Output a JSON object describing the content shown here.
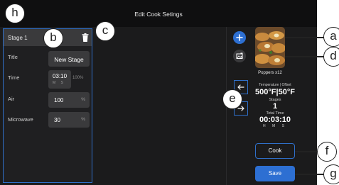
{
  "header": {
    "title": "Edit Cook Setings"
  },
  "stage": {
    "name": "Stage 1",
    "fields": {
      "title": {
        "label": "Title",
        "value": "New Stage"
      },
      "time": {
        "label": "Time",
        "value": "03:10",
        "sub": "M S",
        "percent": "100%"
      },
      "air": {
        "label": "Air",
        "value": "100",
        "unit": "%"
      },
      "microwave": {
        "label": "Microwave",
        "value": "30",
        "unit": "%"
      }
    }
  },
  "recipe": {
    "name": "Poppers x12",
    "temperature_label": "Temperature | Offset",
    "temperature_value": "500°F|50°F",
    "stages_label": "Stages",
    "stages_value": "1",
    "total_time_label": "Total Time",
    "total_time_value": "00:03:10",
    "total_time_sub": "H M S"
  },
  "buttons": {
    "cook": "Cook",
    "save": "Save"
  },
  "icons": {
    "back": "back-arrow-icon",
    "delete": "trash-icon",
    "add": "plus-icon",
    "image": "image-edit-icon",
    "previous": "arrow-left-icon",
    "next": "arrow-right-icon"
  },
  "callouts": {
    "a": "a",
    "b": "b",
    "c": "c",
    "d": "d",
    "e": "e",
    "f": "f",
    "g": "g",
    "h": "h"
  },
  "colors": {
    "accent": "#2d6fd2",
    "background": "#1b1b1c",
    "panel": "#3a3a3c"
  }
}
